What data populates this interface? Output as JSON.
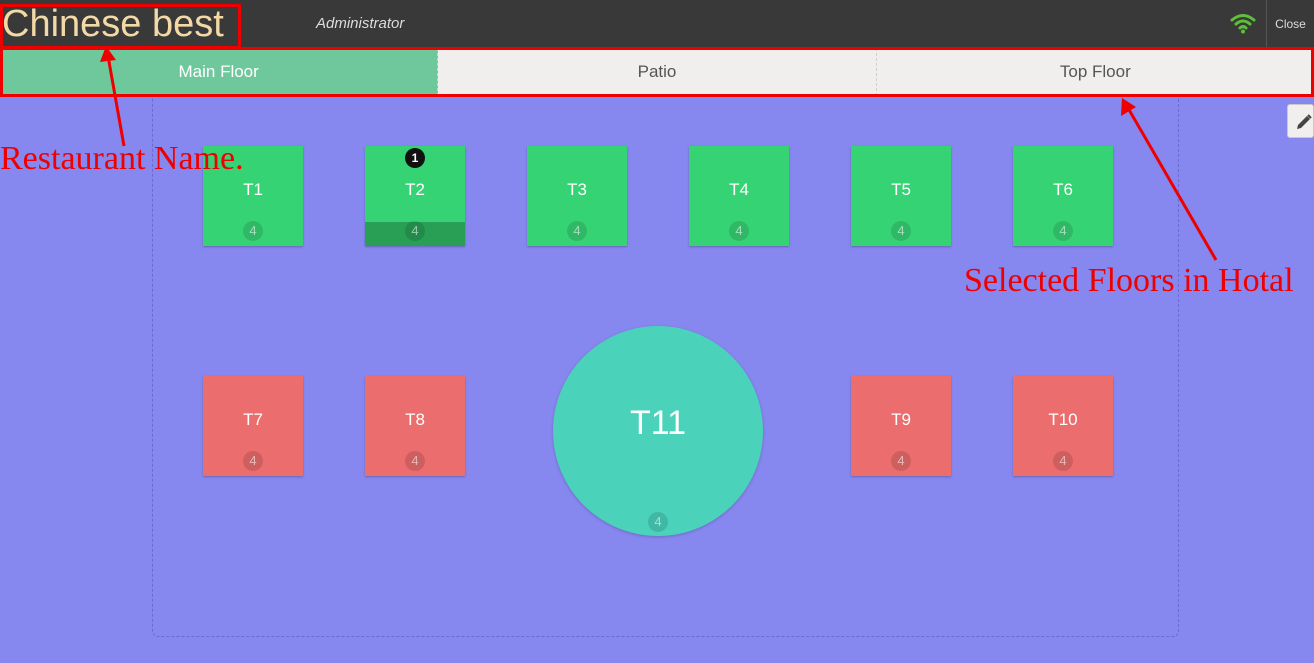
{
  "header": {
    "restaurant_name": "Chinese best",
    "user": "Administrator",
    "wifi_icon": "wifi-icon",
    "close_label": "Close"
  },
  "tabs": [
    {
      "label": "Main Floor",
      "active": true
    },
    {
      "label": "Patio",
      "active": false
    },
    {
      "label": "Top Floor",
      "active": false
    }
  ],
  "tables": [
    {
      "name": "T1",
      "seats": "4",
      "status": "free"
    },
    {
      "name": "T2",
      "seats": "4",
      "status": "occupied",
      "orders": "1"
    },
    {
      "name": "T3",
      "seats": "4",
      "status": "free"
    },
    {
      "name": "T4",
      "seats": "4",
      "status": "free"
    },
    {
      "name": "T5",
      "seats": "4",
      "status": "free"
    },
    {
      "name": "T6",
      "seats": "4",
      "status": "free"
    },
    {
      "name": "T7",
      "seats": "4",
      "status": "reserved"
    },
    {
      "name": "T8",
      "seats": "4",
      "status": "reserved"
    },
    {
      "name": "T9",
      "seats": "4",
      "status": "reserved"
    },
    {
      "name": "T10",
      "seats": "4",
      "status": "reserved"
    },
    {
      "name": "T11",
      "seats": "4",
      "status": "round"
    }
  ],
  "colors": {
    "floor_bg": "#8787f0",
    "table_green": "#36d375",
    "table_red": "#eb6d6d",
    "table_round": "#4bd2bb",
    "active_tab": "#6ec89b",
    "annotation": "#e00000"
  },
  "annotations": {
    "restaurant_name_label": "Restaurant Name.",
    "floors_label": "Selected Floors in Hotal"
  },
  "edit_icon": "pencil-icon"
}
